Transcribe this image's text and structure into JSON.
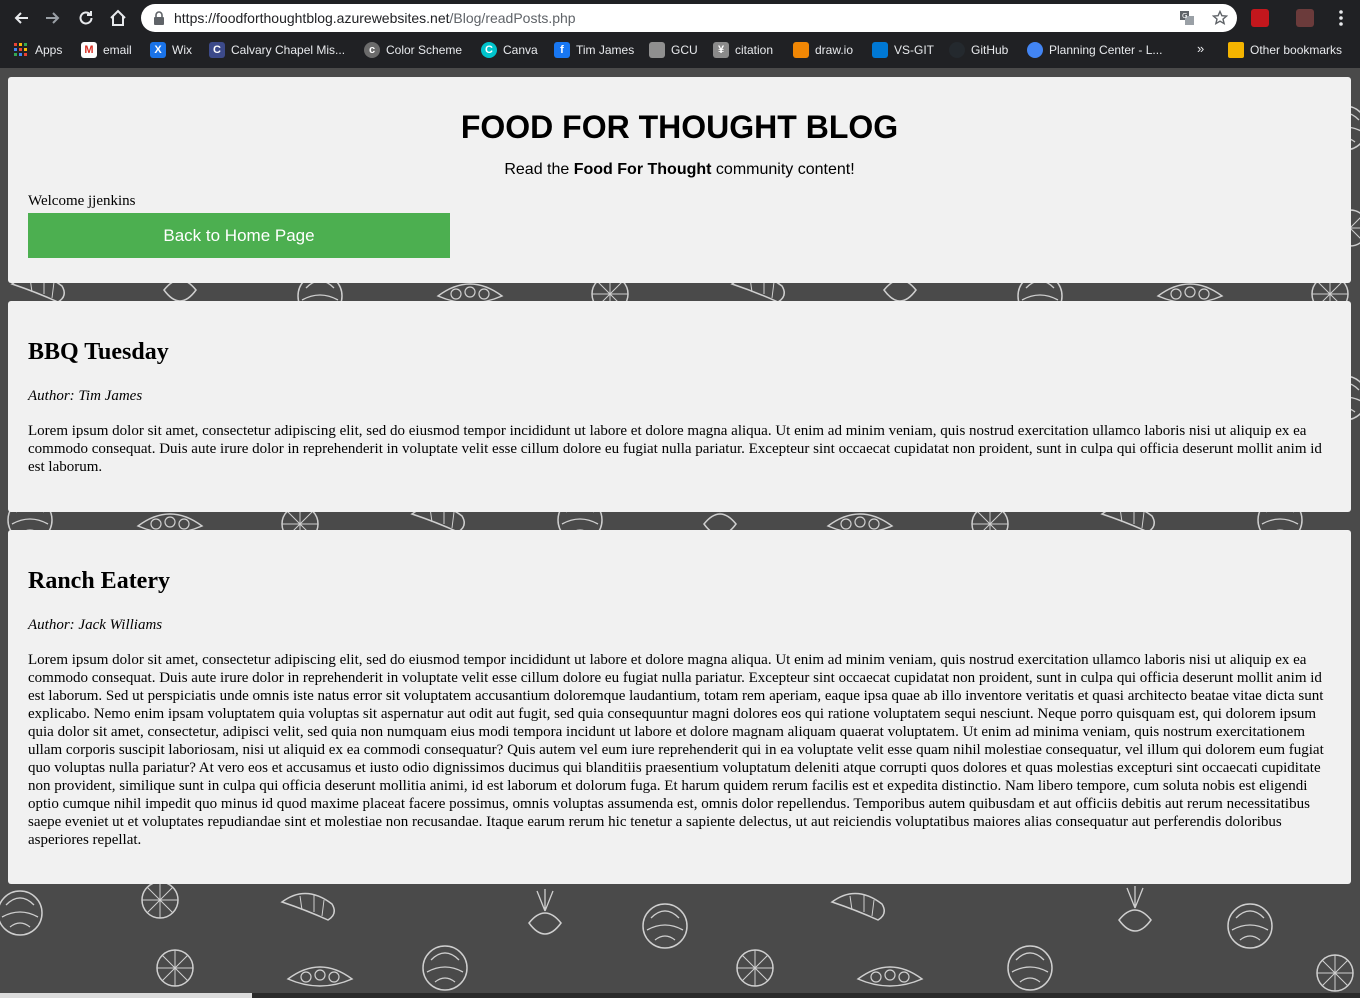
{
  "browser": {
    "url_host": "https://foodforthoughtblog.azurewebsites.net",
    "url_path": "/Blog/readPosts.php",
    "bookmarks": [
      {
        "label": "Apps",
        "icon": "apps-grid-icon",
        "color": "#ea4335"
      },
      {
        "label": "email",
        "icon": "gmail-icon",
        "color": "#d93025"
      },
      {
        "label": "Wix",
        "icon": "wix-icon",
        "color": "#1a73e8"
      },
      {
        "label": "Calvary Chapel Mis...",
        "icon": "calvary-icon",
        "color": "#3c4a8a"
      },
      {
        "label": "Color Scheme",
        "icon": "color-scheme-icon",
        "color": "#6b6b6b"
      },
      {
        "label": "Canva",
        "icon": "canva-icon",
        "color": "#00c4cc"
      },
      {
        "label": "Tim James",
        "icon": "facebook-icon",
        "color": "#1877f2"
      },
      {
        "label": "GCU",
        "icon": "gcu-icon",
        "color": "#8f8f8f"
      },
      {
        "label": "citation",
        "icon": "citation-icon",
        "color": "#8a8a8a"
      },
      {
        "label": "draw.io",
        "icon": "drawio-icon",
        "color": "#f08705"
      },
      {
        "label": "VS-GIT",
        "icon": "azure-devops-icon",
        "color": "#0078d4"
      },
      {
        "label": "GitHub",
        "icon": "github-icon",
        "color": "#24292e"
      },
      {
        "label": "Planning Center - L...",
        "icon": "planning-center-icon",
        "color": "#4285f4"
      }
    ],
    "more_label": "»",
    "other_bookmarks": "Other bookmarks"
  },
  "header": {
    "title": "FOOD FOR THOUGHT BLOG",
    "tagline_prefix": "Read the ",
    "tagline_bold": "Food For Thought",
    "tagline_suffix": " community content!",
    "welcome": "Welcome jjenkins",
    "home_button": "Back to Home Page",
    "button_color": "#4caf50"
  },
  "posts": [
    {
      "title": "BBQ Tuesday",
      "author": "Author: Tim James",
      "body": "Lorem ipsum dolor sit amet, consectetur adipiscing elit, sed do eiusmod tempor incididunt ut labore et dolore magna aliqua. Ut enim ad minim veniam, quis nostrud exercitation ullamco laboris nisi ut aliquip ex ea commodo consequat. Duis aute irure dolor in reprehenderit in voluptate velit esse cillum dolore eu fugiat nulla pariatur. Excepteur sint occaecat cupidatat non proident, sunt in culpa qui officia deserunt mollit anim id est laborum."
    },
    {
      "title": "Ranch Eatery",
      "author": "Author: Jack Williams",
      "body": "Lorem ipsum dolor sit amet, consectetur adipiscing elit, sed do eiusmod tempor incididunt ut labore et dolore magna aliqua. Ut enim ad minim veniam, quis nostrud exercitation ullamco laboris nisi ut aliquip ex ea commodo consequat. Duis aute irure dolor in reprehenderit in voluptate velit esse cillum dolore eu fugiat nulla pariatur. Excepteur sint occaecat cupidatat non proident, sunt in culpa qui officia deserunt mollit anim id est laborum. Sed ut perspiciatis unde omnis iste natus error sit voluptatem accusantium doloremque laudantium, totam rem aperiam, eaque ipsa quae ab illo inventore veritatis et quasi architecto beatae vitae dicta sunt explicabo. Nemo enim ipsam voluptatem quia voluptas sit aspernatur aut odit aut fugit, sed quia consequuntur magni dolores eos qui ratione voluptatem sequi nesciunt. Neque porro quisquam est, qui dolorem ipsum quia dolor sit amet, consectetur, adipisci velit, sed quia non numquam eius modi tempora incidunt ut labore et dolore magnam aliquam quaerat voluptatem. Ut enim ad minima veniam, quis nostrum exercitationem ullam corporis suscipit laboriosam, nisi ut aliquid ex ea commodi consequatur? Quis autem vel eum iure reprehenderit qui in ea voluptate velit esse quam nihil molestiae consequatur, vel illum qui dolorem eum fugiat quo voluptas nulla pariatur? At vero eos et accusamus et iusto odio dignissimos ducimus qui blanditiis praesentium voluptatum deleniti atque corrupti quos dolores et quas molestias excepturi sint occaecati cupiditate non provident, similique sunt in culpa qui officia deserunt mollitia animi, id est laborum et dolorum fuga. Et harum quidem rerum facilis est et expedita distinctio. Nam libero tempore, cum soluta nobis est eligendi optio cumque nihil impedit quo minus id quod maxime placeat facere possimus, omnis voluptas assumenda est, omnis dolor repellendus. Temporibus autem quibusdam et aut officiis debitis aut rerum necessitatibus saepe eveniet ut et voluptates repudiandae sint et molestiae non recusandae. Itaque earum rerum hic tenetur a sapiente delectus, ut aut reiciendis voluptatibus maiores alias consequatur aut perferendis doloribus asperiores repellat."
    }
  ],
  "theme": {
    "page_background": "#4a4a4a",
    "card_background": "#f1f1f1"
  }
}
